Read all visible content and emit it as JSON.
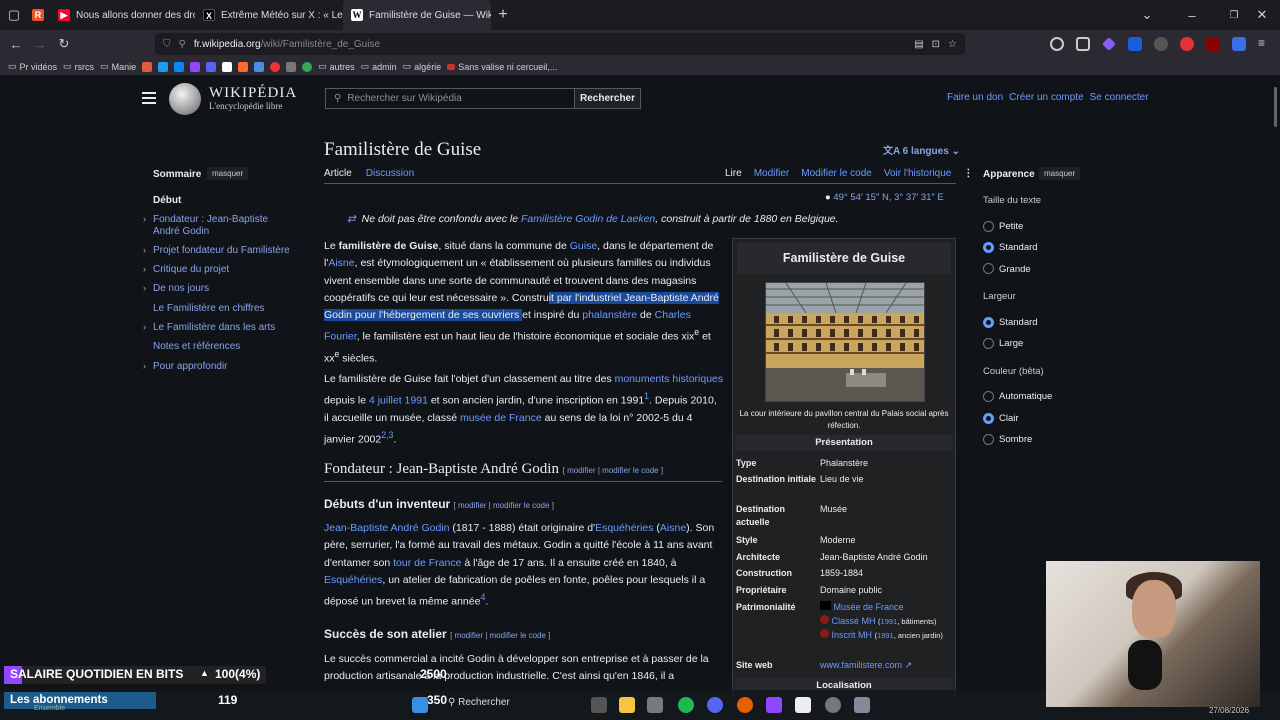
{
  "browser": {
    "tabs": [
      {
        "title": "Nous allons donner des droits à",
        "icon_color": "#ff0033",
        "active": false
      },
      {
        "title": "Extrême Météo sur X : « Les ind",
        "icon_color": "#000000",
        "active": false
      },
      {
        "title": "Familistère de Guise — Wikipédi",
        "icon_color": "#ffffff",
        "active": true
      }
    ],
    "url_host": "fr.wikipedia.org",
    "url_path": "/wiki/Familistère_de_Guise",
    "bookmarks": [
      "Pr vidéos",
      "rsrcs",
      "Manie",
      "autres",
      "admin",
      "algérie",
      "Sans valise ni cercueil,..."
    ]
  },
  "wiki": {
    "wordmark": "WIKIPÉDIA",
    "tagline": "L'encyclopédie libre",
    "search_placeholder": "Rechercher sur Wikipédia",
    "search_button": "Rechercher",
    "user_links": [
      "Faire un don",
      "Créer un compte",
      "Se connecter"
    ],
    "toc": {
      "title": "Sommaire",
      "hide": "masquer",
      "items": [
        {
          "label": "Début",
          "current": true,
          "expandable": false
        },
        {
          "label": "Fondateur : Jean-Baptiste André Godin",
          "current": false,
          "expandable": true
        },
        {
          "label": "Projet fondateur du Familistère",
          "current": false,
          "expandable": true
        },
        {
          "label": "Critique du projet",
          "current": false,
          "expandable": true
        },
        {
          "label": "De nos jours",
          "current": false,
          "expandable": true
        },
        {
          "label": "Le Familistère en chiffres",
          "current": false,
          "expandable": false
        },
        {
          "label": "Le Familistère dans les arts",
          "current": false,
          "expandable": true
        },
        {
          "label": "Notes et références",
          "current": false,
          "expandable": false
        },
        {
          "label": "Pour approfondir",
          "current": false,
          "expandable": true
        }
      ]
    },
    "title": "Familistère de Guise",
    "languages": "6 langues",
    "tabs_left": [
      "Article",
      "Discussion"
    ],
    "tabs_right": [
      "Lire",
      "Modifier",
      "Modifier le code",
      "Voir l'historique"
    ],
    "coordinates": "49° 54′ 15″ N, 3° 37′ 31″ E",
    "hatnote": {
      "before": "Ne doit pas être confondu avec le ",
      "link": "Familistère Godin de Laeken",
      "after": ", construit à partir de 1880 en Belgique."
    },
    "para1": {
      "t1": "Le ",
      "b1": "familistère de Guise",
      "t2": ", situé dans la commune de ",
      "l1": "Guise",
      "t3": ", dans le département de l'",
      "l2": "Aisne",
      "t4": ", est étymologiquement un « établissement où plusieurs familles ou individus vivent ensemble dans une sorte de communauté et trouvent dans des magasins coopératifs ce qui leur est nécessaire ». Constru",
      "h1": "it par l'industriel Jean-Baptiste André Godin pour l'hébergement de ses ouvriers ",
      "t5": "et inspiré du ",
      "l3": "phalanstère",
      "t6": " de ",
      "l4": "Charles Fourier",
      "t7": ", le familistère est un haut lieu de l'histoire économique et sociale des xix",
      "s1": "e",
      "t8": " et xx",
      "s2": "e",
      "t9": " siècles."
    },
    "para2": {
      "t1": "Le familistère de Guise fait l'objet d'un classement au titre des ",
      "l1": "monuments historiques",
      "t2": " depuis le ",
      "l2": "4 juillet 1991",
      "t3": " et son ancien jardin, d'une inscription en 1991",
      "r1": "1",
      "t4": ". Depuis 2010, il accueille un musée, classé ",
      "l3": "musée de France",
      "t5": " au sens de la loi n° 2002-5 du 4 janvier 2002",
      "r2": "2,3",
      "t6": "."
    },
    "h2_founder": "Fondateur : Jean-Baptiste André Godin",
    "edit_links": [
      "modifier",
      "modifier le code"
    ],
    "h3_debuts": "Débuts d'un inventeur",
    "para3": {
      "l1": "Jean-Baptiste André Godin",
      "t1": " (1817 - 1888) était originaire d'",
      "l2": "Esquéhéries",
      "t2": " (",
      "l3": "Aisne",
      "t3": "). Son père, serrurier, l'a formé au travail des métaux. Godin a quitté l'école à 11 ans avant d'entamer son ",
      "l4": "tour de France",
      "t4": " à l'âge de 17 ans. Il a ensuite créé en 1840, à ",
      "l5": "Esquéhéries",
      "t5": ", un atelier de fabrication de poêles en fonte, poêles pour lesquels il a déposé un brevet la même année",
      "r1": "4",
      "t6": "."
    },
    "h3_succes": "Succès de son atelier",
    "para4": "Le succès commercial a incité Godin à développer son entreprise et à passer de la production artisanale à la production industrielle. C'est ainsi qu'en 1846, il a",
    "infobox": {
      "title": "Familistère de Guise",
      "caption": "La cour intérieure du pavillon central du Palais social après réfection.",
      "section": "Présentation",
      "rows": [
        {
          "label": "Type",
          "value": "Phalanstère",
          "link": true
        },
        {
          "label": "Destination initiale",
          "value": "Lieu de vie",
          "link": false
        },
        {
          "label": "Destination actuelle",
          "value": "Musée",
          "link": false
        },
        {
          "label": "Style",
          "value": "Moderne",
          "link": false
        },
        {
          "label": "Architecte",
          "value": "Jean-Baptiste André Godin",
          "link": false
        },
        {
          "label": "Construction",
          "value": "1859-1884",
          "link": false
        },
        {
          "label": "Propriétaire",
          "value": "Domaine public",
          "link": false
        }
      ],
      "patrimoine_label": "Patrimonialité",
      "patrimoine": [
        {
          "link": "Musée de France",
          "detail": ""
        },
        {
          "link": "Classé MH",
          "detail_link": "1991",
          "detail": ", bâtiments)"
        },
        {
          "link": "Inscrit MH",
          "detail_link": "1991",
          "detail": ", ancien jardin)"
        }
      ],
      "site_label": "Site web",
      "site": "www.familistere.com",
      "localisation": "Localisation"
    },
    "appearance": {
      "title": "Apparence",
      "hide": "masquer",
      "text_size_title": "Taille du texte",
      "text_sizes": [
        "Petite",
        "Standard",
        "Grande"
      ],
      "text_size_selected": "Standard",
      "width_title": "Largeur",
      "widths": [
        "Standard",
        "Large"
      ],
      "width_selected": "Standard",
      "color_title": "Couleur (bêta)",
      "colors": [
        "Automatique",
        "Clair",
        "Sombre"
      ],
      "color_selected": "Clair"
    }
  },
  "overlay": {
    "salaire_label": "SALAIRE QUOTIDIEN EN BITS",
    "salaire_value": "100(4%)",
    "salaire_total": "2500",
    "abonnements_label": "Les abonnements",
    "abonnements_value": "119",
    "abonnements_goal": "350",
    "ensemble": "Ensemble",
    "taskbar_search": "Rechercher",
    "date": "27/08/2026"
  }
}
